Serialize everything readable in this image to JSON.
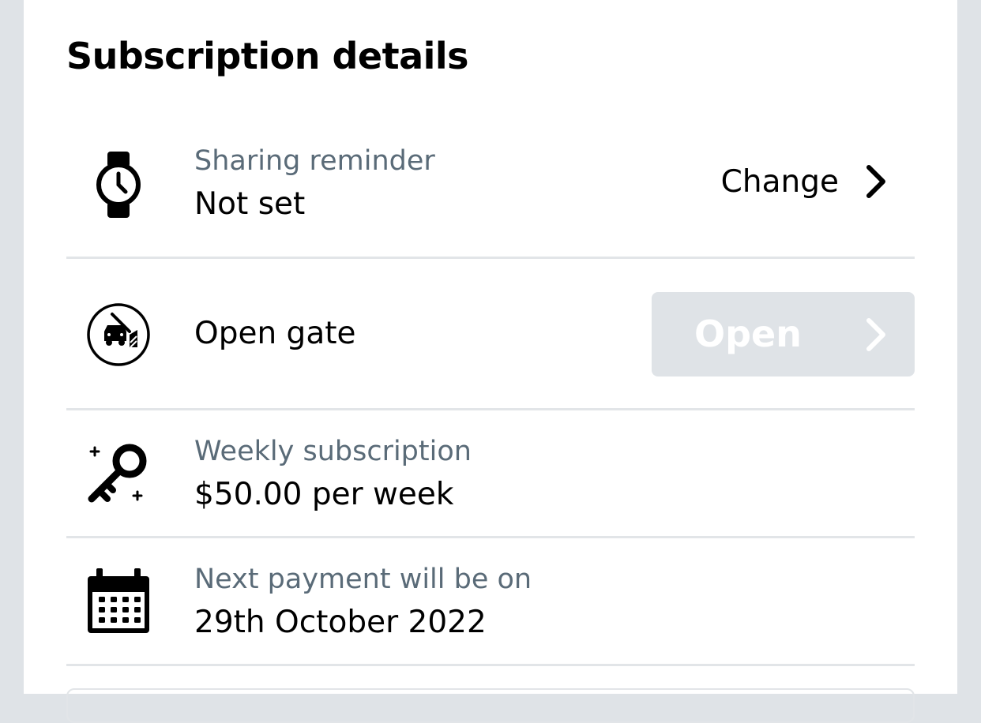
{
  "page": {
    "title": "Subscription details"
  },
  "rows": {
    "reminder": {
      "icon": "watch-icon",
      "label": "Sharing reminder",
      "value": "Not set",
      "action_label": "Change"
    },
    "gate": {
      "icon": "gate-car-icon",
      "value": "Open gate",
      "action_label": "Open",
      "action_disabled": true
    },
    "subscription": {
      "icon": "key-icon",
      "label": "Weekly subscription",
      "value": "$50.00 per week"
    },
    "payment": {
      "icon": "calendar-icon",
      "label": "Next payment will be on",
      "value": "29th October 2022"
    }
  },
  "colors": {
    "background": "#dfe3e7",
    "card": "#ffffff",
    "label_gray": "#5a6b78",
    "divider": "#e2e5e8",
    "disabled_button": "#dfe3e7"
  }
}
